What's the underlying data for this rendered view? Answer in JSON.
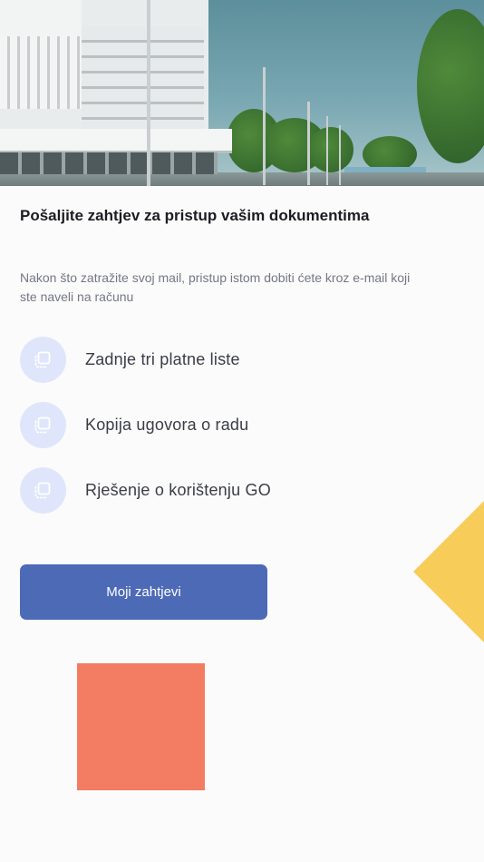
{
  "hero": {
    "image_name": "building-photo"
  },
  "content": {
    "title": "Pošaljite zahtjev za pristup vašim dokumentima",
    "description": "Nakon što zatražite svoj mail, pristup istom dobiti ćete kroz e-mail koji ste naveli na računu"
  },
  "documents": [
    {
      "label": "Zadnje tri platne liste",
      "icon": "document-icon"
    },
    {
      "label": "Kopija ugovora o radu",
      "icon": "document-icon"
    },
    {
      "label": "Rješenje o korištenju GO",
      "icon": "document-icon"
    }
  ],
  "actions": {
    "my_requests_label": "Moji zahtjevi"
  },
  "colors": {
    "accent": "#4d6ab6",
    "icon_background": "#dfe6fb",
    "decor_yellow": "#f7cc58",
    "decor_salmon": "#f27d62"
  }
}
